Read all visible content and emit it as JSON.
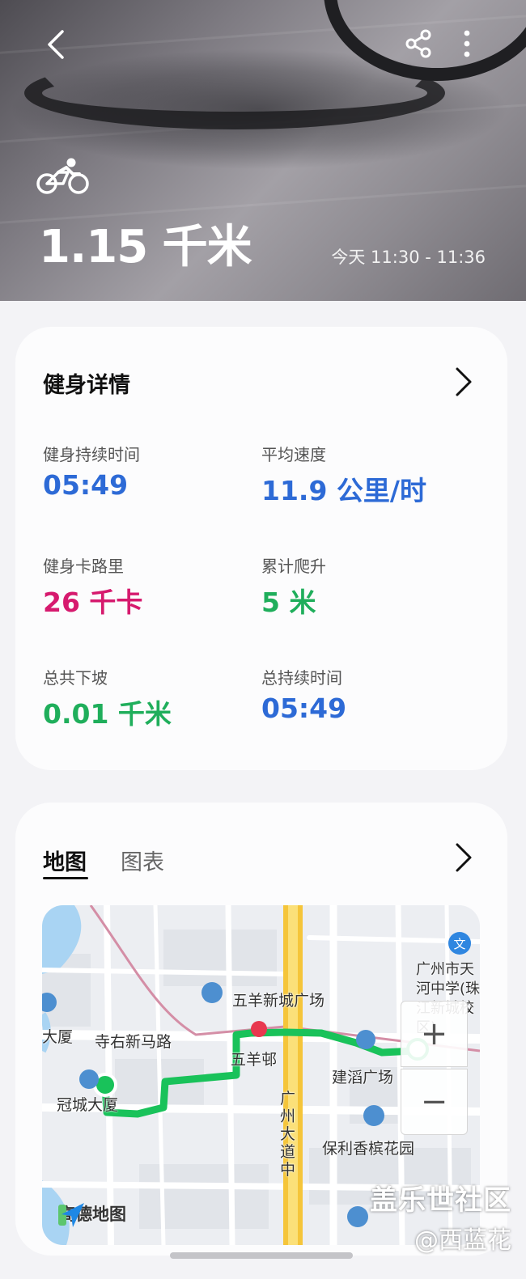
{
  "header": {
    "distance": "1.15 千米",
    "time_range": "今天 11:30 - 11:36"
  },
  "icons": {
    "back": "chevron-left-icon",
    "share": "share-icon",
    "more": "more-vertical-icon",
    "activity": "cycling-icon"
  },
  "details": {
    "title": "健身详情",
    "stats": [
      {
        "label": "健身持续时间",
        "value": "05:49",
        "color": "#2d6ad6"
      },
      {
        "label": "平均速度",
        "value": "11.9 公里/时",
        "color": "#2d6ad6"
      },
      {
        "label": "健身卡路里",
        "value": "26 千卡",
        "color": "#d61a6e"
      },
      {
        "label": "累计爬升",
        "value": "5 米",
        "color": "#1fae5b"
      },
      {
        "label": "总共下坡",
        "value": "0.01 千米",
        "color": "#1fae5b"
      },
      {
        "label": "总持续时间",
        "value": "05:49",
        "color": "#2d6ad6"
      }
    ]
  },
  "map_card": {
    "tabs": [
      "地图",
      "图表"
    ],
    "active_tab": "地图",
    "labels": {
      "wuyang_square": "五羊新城广场",
      "dasha": "大厦",
      "sixin_road": "寺右新马路",
      "wuyang_village": "五羊邨",
      "jiandao_square": "建滔广场",
      "guancheng": "冠城大厦",
      "guangzhou_avenue": "广州大道中",
      "baoli": "保利香槟花园",
      "school": "广州市天河中学(珠江新城校区)",
      "logo": "高德地图"
    },
    "zoom_in": "+",
    "zoom_out": "−"
  },
  "watermark": {
    "line1": "盖乐世社区",
    "line2": "@西蓝花"
  },
  "colors": {
    "accent_blue": "#2d6ad6",
    "route_green": "#19c25a",
    "calorie_pink": "#d61a6e"
  }
}
